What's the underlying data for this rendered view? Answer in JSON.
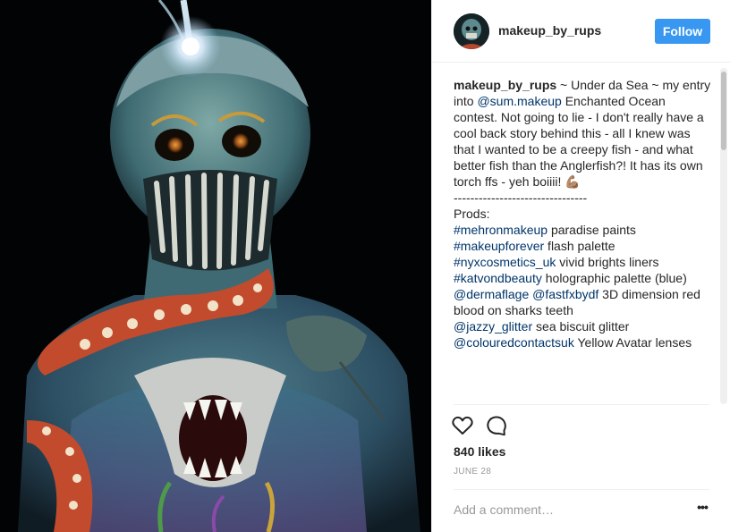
{
  "post": {
    "username": "makeup_by_rups",
    "follow_label": "Follow",
    "caption": {
      "user": "makeup_by_rups",
      "segments": [
        {
          "t": " ~ Under da Sea ~ my entry into ",
          "link": false
        },
        {
          "t": "@sum.makeup",
          "link": true
        },
        {
          "t": " Enchanted Ocean contest. Not going to lie - I don't really have a cool back story behind this - all I knew was that I wanted to be a creepy fish - and what better fish than the Anglerfish?! It has its own torch ffs - yeh boiiii! 💪🏽",
          "link": false
        },
        {
          "t": "\n--------------------------------\nProds:\n",
          "link": false
        },
        {
          "t": "#mehronmakeup",
          "link": true
        },
        {
          "t": " paradise paints\n",
          "link": false
        },
        {
          "t": "#makeupforever",
          "link": true
        },
        {
          "t": " flash palette\n",
          "link": false
        },
        {
          "t": "#nyxcosmetics_uk",
          "link": true
        },
        {
          "t": " vivid brights liners\n",
          "link": false
        },
        {
          "t": "#katvondbeauty",
          "link": true
        },
        {
          "t": " holographic palette (blue)\n",
          "link": false
        },
        {
          "t": "@dermaflage",
          "link": true
        },
        {
          "t": " ",
          "link": false
        },
        {
          "t": "@fastfxbydf",
          "link": true
        },
        {
          "t": " 3D dimension red blood on sharks teeth\n",
          "link": false
        },
        {
          "t": "@jazzy_glitter",
          "link": true
        },
        {
          "t": " sea biscuit glitter\n",
          "link": false
        },
        {
          "t": "@colouredcontactsuk",
          "link": true
        },
        {
          "t": " Yellow Avatar lenses",
          "link": false
        }
      ]
    },
    "likes": "840 likes",
    "date": "JUNE 28",
    "comment_placeholder": "Add a comment…",
    "more_label": "•••"
  },
  "icons": {
    "like": "heart-icon",
    "comment": "comment-bubble-icon",
    "more": "more-options-icon"
  },
  "colors": {
    "follow_button": "#3897f0",
    "link": "#003569",
    "text": "#262626",
    "muted": "#999999",
    "photo_background": "#000000"
  }
}
